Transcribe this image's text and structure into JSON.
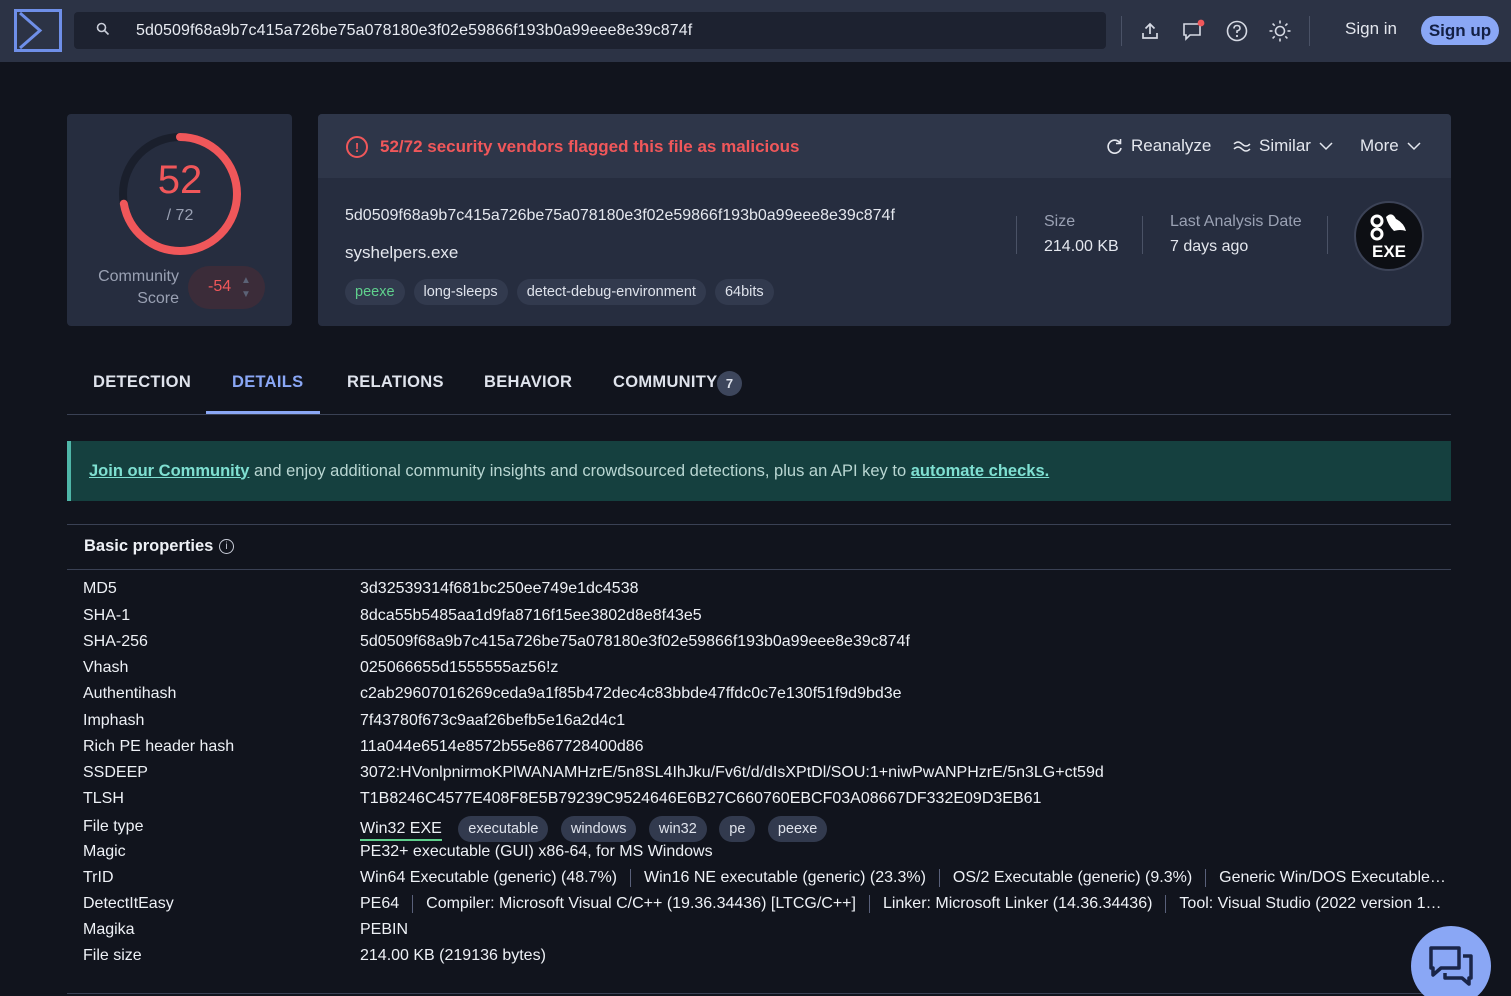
{
  "header": {
    "search_value": "5d0509f68a9b7c415a726be75a078180e3f02e59866f193b0a99eee8e39c874f",
    "sign_in": "Sign in",
    "sign_up": "Sign up"
  },
  "score": {
    "detections": "52",
    "total": "/ 72",
    "detection_ratio": 0.722,
    "community_label_line1": "Community",
    "community_label_line2": "Score",
    "community_value": "-54"
  },
  "summary": {
    "alert": "52/72 security vendors flagged this file as malicious",
    "reanalyze": "Reanalyze",
    "similar": "Similar",
    "more": "More",
    "hash": "5d0509f68a9b7c415a726be75a078180e3f02e59866f193b0a99eee8e39c874f",
    "filename": "syshelpers.exe",
    "tags": [
      "peexe",
      "long-sleeps",
      "detect-debug-environment",
      "64bits"
    ],
    "size_label": "Size",
    "size_value": "214.00 KB",
    "date_label": "Last Analysis Date",
    "date_value": "7 days ago",
    "badge_text": "EXE"
  },
  "tabs": {
    "detection": "DETECTION",
    "details": "DETAILS",
    "relations": "RELATIONS",
    "behavior": "BEHAVIOR",
    "community": "COMMUNITY",
    "community_count": "7"
  },
  "banner": {
    "link1": "Join our Community",
    "middle": " and enjoy additional community insights and crowdsourced detections, plus an API key to ",
    "link2": "automate checks."
  },
  "basic": {
    "title": "Basic properties",
    "rows": [
      {
        "key": "MD5",
        "value": "3d32539314f681bc250ee749e1dc4538"
      },
      {
        "key": "SHA-1",
        "value": "8dca55b5485aa1d9fa8716f15ee3802d8e8f43e5"
      },
      {
        "key": "SHA-256",
        "value": "5d0509f68a9b7c415a726be75a078180e3f02e59866f193b0a99eee8e39c874f"
      },
      {
        "key": "Vhash",
        "value": "025066655d1555555az56!z"
      },
      {
        "key": "Authentihash",
        "value": "c2ab29607016269ceda9a1f85b472dec4c83bbde47ffdc0c7e130f51f9d9bd3e"
      },
      {
        "key": "Imphash",
        "value": "7f43780f673c9aaf26befb5e16a2d4c1"
      },
      {
        "key": "Rich PE header hash",
        "value": "11a044e6514e8572b55e867728400d86"
      },
      {
        "key": "SSDEEP",
        "value": "3072:HVonlpnirmoKPlWANAMHzrE/5n8SL4IhJku/Fv6t/d/dIsXPtDl/SOU:1+niwPwANPHzrE/5n3LG+ct59d"
      },
      {
        "key": "TLSH",
        "value": "T1B8246C4577E408F8E5B79239C9524646E6B27C660760EBCF03A08667DF332E09D3EB61"
      }
    ],
    "file_type_key": "File type",
    "file_type_main": "Win32 EXE",
    "file_type_tags": [
      "executable",
      "windows",
      "win32",
      "pe",
      "peexe"
    ],
    "magic_key": "Magic",
    "magic_value": "PE32+ executable (GUI) x86-64, for MS Windows",
    "trid_key": "TrID",
    "trid": [
      "Win64 Executable (generic) (48.7%)",
      "Win16 NE executable (generic) (23.3%)",
      "OS/2 Executable (generic) (9.3%)",
      "Generic Win/DOS Executable…"
    ],
    "die_key": "DetectItEasy",
    "die": [
      "PE64",
      "Compiler: Microsoft Visual C/C++ (19.36.34436) [LTCG/C++]",
      "Linker: Microsoft Linker (14.36.34436)",
      "Tool: Visual Studio (2022 version 1…"
    ],
    "magika_key": "Magika",
    "magika_value": "PEBIN",
    "filesize_key": "File size",
    "filesize_value": "214.00 KB (219136 bytes)"
  },
  "colors": {
    "accent": "#8aa7f5",
    "danger": "#f0575a",
    "good": "#5fd08d"
  }
}
